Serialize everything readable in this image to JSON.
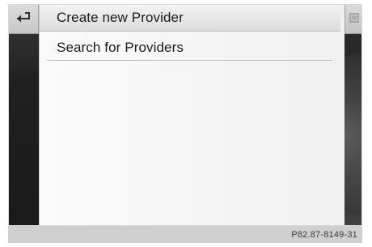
{
  "menu": {
    "items": [
      {
        "label": "Create new Provider",
        "selected": true
      },
      {
        "label": "Search for Providers",
        "selected": false
      }
    ]
  },
  "icons": {
    "back": "back-arrow-icon",
    "options": "options-icon"
  },
  "caption": {
    "figure_id": "P82.87-8149-31"
  },
  "colors": {
    "selected_bg": "#dcdcdc",
    "text": "#1b1b1b",
    "rail_dark": "#1f1f1f",
    "caption_bg": "#cfcfcf"
  }
}
